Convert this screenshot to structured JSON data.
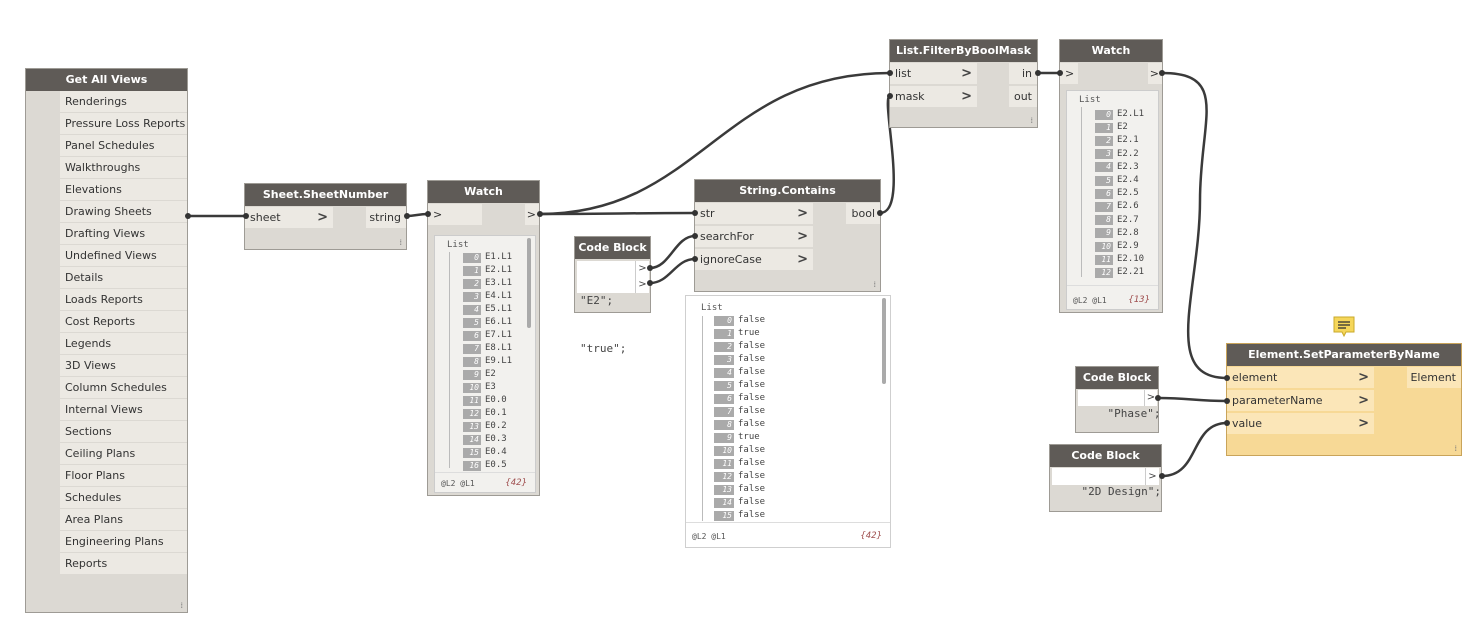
{
  "nodes": {
    "get_all_views": {
      "title": "Get All Views",
      "items": [
        "Renderings",
        "Pressure Loss Reports",
        "Panel Schedules",
        "Walkthroughs",
        "Elevations",
        "Drawing Sheets",
        "Drafting Views",
        "Undefined Views",
        "Details",
        "Loads Reports",
        "Cost Reports",
        "Legends",
        "3D Views",
        "Column Schedules",
        "Internal Views",
        "Sections",
        "Ceiling Plans",
        "Floor Plans",
        "Schedules",
        "Area Plans",
        "Engineering Plans",
        "Reports"
      ]
    },
    "sheet_number": {
      "title": "Sheet.SheetNumber",
      "input": "sheet",
      "output": "string"
    },
    "watch1": {
      "title": "Watch",
      "in_symbol": ">",
      "out_symbol": ">",
      "list_title": "List",
      "items": [
        {
          "idx": "0",
          "val": "E1.L1"
        },
        {
          "idx": "1",
          "val": "E2.L1"
        },
        {
          "idx": "2",
          "val": "E3.L1"
        },
        {
          "idx": "3",
          "val": "E4.L1"
        },
        {
          "idx": "4",
          "val": "E5.L1"
        },
        {
          "idx": "5",
          "val": "E6.L1"
        },
        {
          "idx": "6",
          "val": "E7.L1"
        },
        {
          "idx": "7",
          "val": "E8.L1"
        },
        {
          "idx": "8",
          "val": "E9.L1"
        },
        {
          "idx": "9",
          "val": "E2"
        },
        {
          "idx": "10",
          "val": "E3"
        },
        {
          "idx": "11",
          "val": "E0.0"
        },
        {
          "idx": "12",
          "val": "E0.1"
        },
        {
          "idx": "13",
          "val": "E0.2"
        },
        {
          "idx": "14",
          "val": "E0.3"
        },
        {
          "idx": "15",
          "val": "E0.4"
        },
        {
          "idx": "16",
          "val": "E0.5"
        }
      ],
      "footer": "@L2 @L1",
      "count": "{42}"
    },
    "code_block1": {
      "title": "Code Block",
      "lines": [
        "\"E2\";",
        "\"true\";"
      ],
      "out_symbol": ">"
    },
    "string_contains": {
      "title": "String.Contains",
      "inputs": [
        "str",
        "searchFor",
        "ignoreCase"
      ],
      "output": "bool"
    },
    "bool_preview": {
      "list_title": "List",
      "items": [
        {
          "idx": "0",
          "val": "false"
        },
        {
          "idx": "1",
          "val": "true"
        },
        {
          "idx": "2",
          "val": "false"
        },
        {
          "idx": "3",
          "val": "false"
        },
        {
          "idx": "4",
          "val": "false"
        },
        {
          "idx": "5",
          "val": "false"
        },
        {
          "idx": "6",
          "val": "false"
        },
        {
          "idx": "7",
          "val": "false"
        },
        {
          "idx": "8",
          "val": "false"
        },
        {
          "idx": "9",
          "val": "true"
        },
        {
          "idx": "10",
          "val": "false"
        },
        {
          "idx": "11",
          "val": "false"
        },
        {
          "idx": "12",
          "val": "false"
        },
        {
          "idx": "13",
          "val": "false"
        },
        {
          "idx": "14",
          "val": "false"
        },
        {
          "idx": "15",
          "val": "false"
        }
      ],
      "footer": "@L2 @L1",
      "count": "{42}"
    },
    "filter_bool_mask": {
      "title": "List.FilterByBoolMask",
      "inputs": [
        "list",
        "mask"
      ],
      "outputs": [
        "in",
        "out"
      ]
    },
    "watch2": {
      "title": "Watch",
      "in_symbol": ">",
      "out_symbol": ">",
      "list_title": "List",
      "items": [
        {
          "idx": "0",
          "val": "E2.L1"
        },
        {
          "idx": "1",
          "val": "E2"
        },
        {
          "idx": "2",
          "val": "E2.1"
        },
        {
          "idx": "3",
          "val": "E2.2"
        },
        {
          "idx": "4",
          "val": "E2.3"
        },
        {
          "idx": "5",
          "val": "E2.4"
        },
        {
          "idx": "6",
          "val": "E2.5"
        },
        {
          "idx": "7",
          "val": "E2.6"
        },
        {
          "idx": "8",
          "val": "E2.7"
        },
        {
          "idx": "9",
          "val": "E2.8"
        },
        {
          "idx": "10",
          "val": "E2.9"
        },
        {
          "idx": "11",
          "val": "E2.10"
        },
        {
          "idx": "12",
          "val": "E2.21"
        }
      ],
      "footer": "@L2 @L1",
      "count": "{13}"
    },
    "code_block2": {
      "title": "Code Block",
      "line": "\"Phase\";",
      "out_symbol": ">"
    },
    "code_block3": {
      "title": "Code Block",
      "line": "\"2D Design\";",
      "out_symbol": ">"
    },
    "set_param": {
      "title": "Element.SetParameterByName",
      "inputs": [
        "element",
        "parameterName",
        "value"
      ],
      "output": "Element"
    }
  },
  "colors": {
    "title_bar": "#5f5b57",
    "node_body": "#dcd9d3",
    "selected_node": "#f7d996",
    "wire": "#3a3a3a",
    "canvas": "#ffffff"
  },
  "icons": {
    "note": "note-icon",
    "port_chevron": "chevron-right-icon",
    "resize_grip": "resize-grip-icon"
  }
}
